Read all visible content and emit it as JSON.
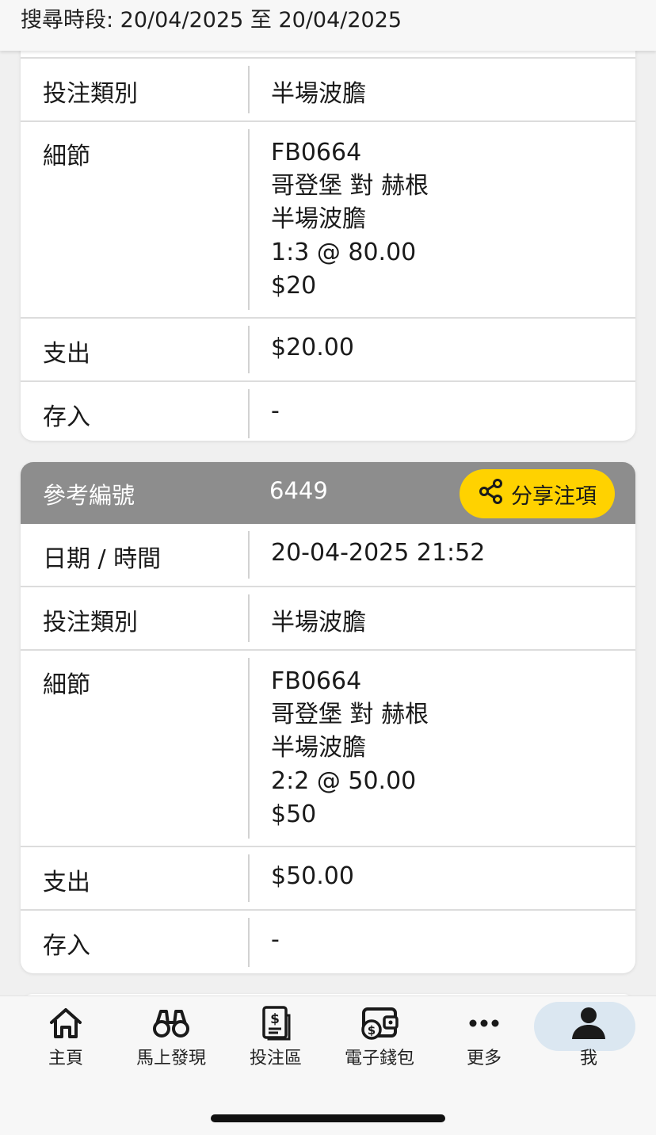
{
  "search": {
    "range_text": "搜尋時段: 20/04/2025 至 20/04/2025"
  },
  "card1": {
    "bet_type_label": "投注類別",
    "bet_type_value": "半場波膽",
    "details_label": "細節",
    "details_lines": [
      "FB0664",
      "哥登堡 對 赫根",
      "半場波膽",
      "1:3 @ 80.00",
      "$20"
    ],
    "expense_label": "支出",
    "expense_value": "$20.00",
    "deposit_label": "存入",
    "deposit_value": "-"
  },
  "card2": {
    "ref_label": "參考編號",
    "ref_value": "6449",
    "share_label": "分享注項",
    "datetime_label": "日期 / 時間",
    "datetime_value": "20-04-2025 21:52",
    "bet_type_label": "投注類別",
    "bet_type_value": "半場波膽",
    "details_label": "細節",
    "details_lines": [
      "FB0664",
      "哥登堡 對 赫根",
      "半場波膽",
      "2:2 @ 50.00",
      "$50"
    ],
    "expense_label": "支出",
    "expense_value": "$50.00",
    "deposit_label": "存入",
    "deposit_value": "-"
  },
  "nav": {
    "items": [
      {
        "label": "主頁",
        "icon": "home-icon"
      },
      {
        "label": "馬上發現",
        "icon": "binoculars-icon"
      },
      {
        "label": "投注區",
        "icon": "betslip-icon"
      },
      {
        "label": "電子錢包",
        "icon": "wallet-icon"
      },
      {
        "label": "更多",
        "icon": "more-icon"
      },
      {
        "label": "我",
        "icon": "user-icon"
      }
    ],
    "active_index": 5
  },
  "colors": {
    "header_gray": "#8d8d8d",
    "accent_yellow": "#ffd200",
    "active_pill": "#dbe7f1"
  }
}
